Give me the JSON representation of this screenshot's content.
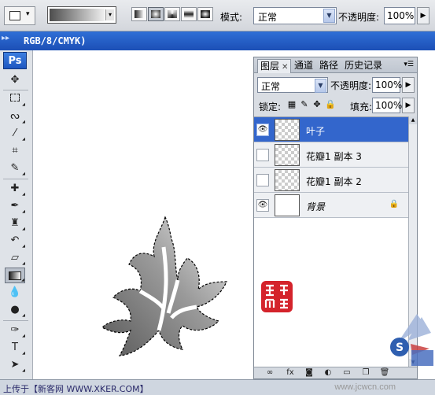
{
  "options_bar": {
    "mode_label": "模式:",
    "mode_value": "正常",
    "opacity_label": "不透明度:",
    "opacity_value": "100%",
    "gradient_types": [
      "linear",
      "radial",
      "angle",
      "reflected",
      "diamond"
    ],
    "active_gradient_type": "radial"
  },
  "document": {
    "title": "RGB/8/CMYK)"
  },
  "toolbox": {
    "logo": "Ps",
    "active_tool": "gradient-tool"
  },
  "layers_panel": {
    "tabs": [
      {
        "label": "图层",
        "active": true,
        "closable": true
      },
      {
        "label": "通道",
        "active": false
      },
      {
        "label": "路径",
        "active": false
      },
      {
        "label": "历史记录",
        "active": false
      }
    ],
    "blend_mode": "正常",
    "opacity_label": "不透明度:",
    "opacity_value": "100%",
    "lock_label": "锁定:",
    "fill_label": "填充:",
    "fill_value": "100%",
    "layers": [
      {
        "name": "叶子",
        "visible": true,
        "selected": true,
        "thumb": "transparent"
      },
      {
        "name": "花瓣1 副本 3",
        "visible": false,
        "selected": false,
        "thumb": "transparent"
      },
      {
        "name": "花瓣1 副本 2",
        "visible": false,
        "selected": false,
        "thumb": "transparent"
      },
      {
        "name": "背景",
        "visible": true,
        "selected": false,
        "thumb": "white",
        "locked": true,
        "italic": true
      }
    ]
  },
  "status_bar": {
    "text": "上传于【新客网 WWW.XKER.COM】",
    "watermark": "www.jcwcn.com"
  },
  "colors": {
    "title_bar": "#2a62cc",
    "selected_layer": "#3366cc",
    "panel_bg": "#d9dde3",
    "seal_red": "#d4232b"
  }
}
